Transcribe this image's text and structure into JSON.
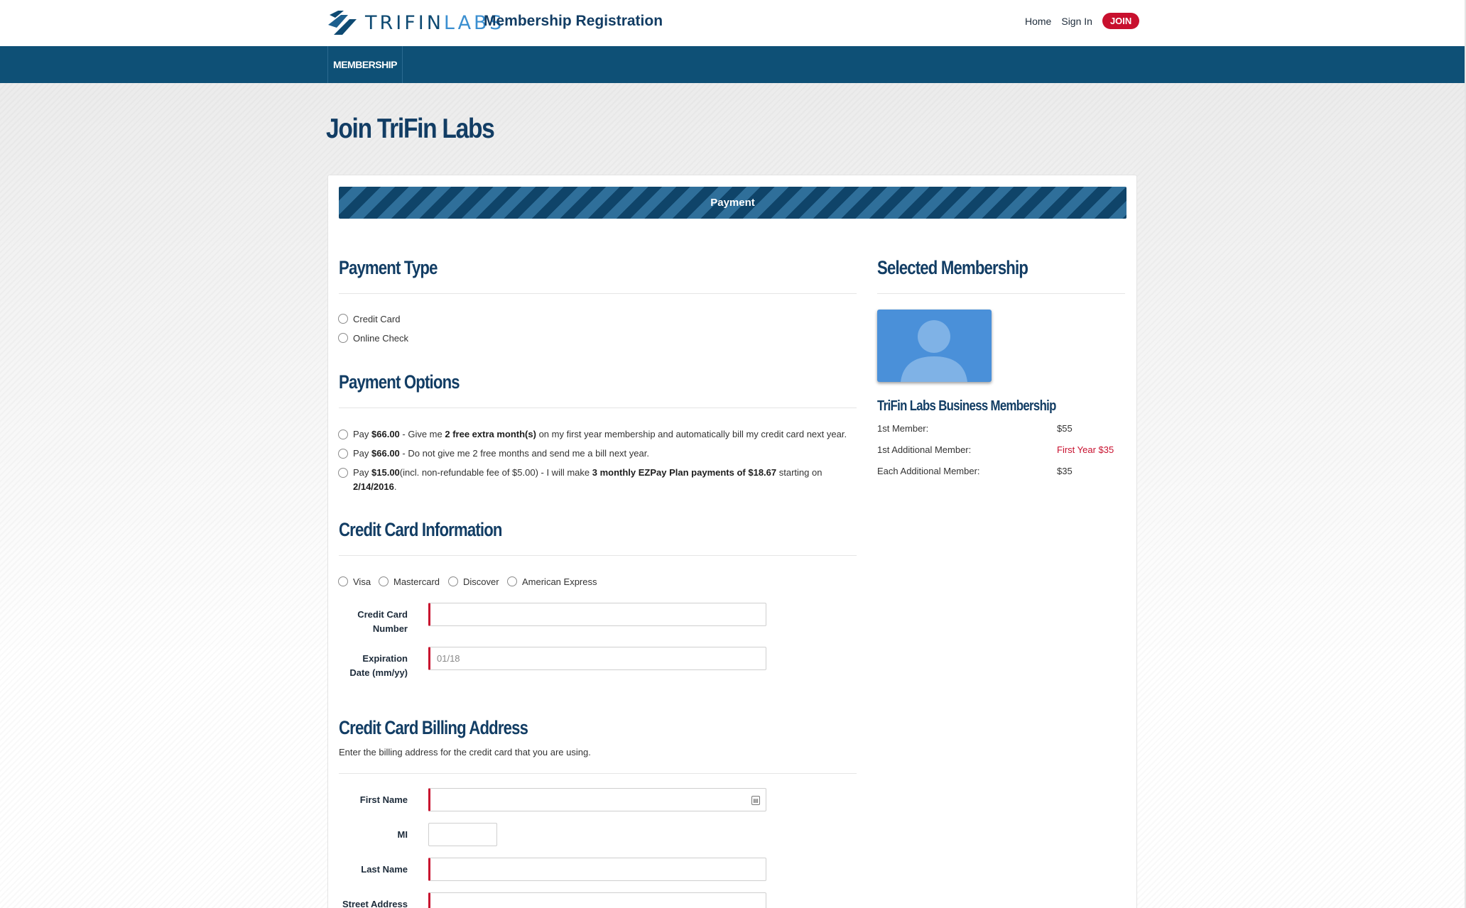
{
  "header": {
    "brand_left": "TRIFIN",
    "brand_right": "LABS",
    "site_title": "Membership Registration",
    "nav": {
      "home": "Home",
      "sign_in": "Sign In",
      "join": "JOIN"
    }
  },
  "navbar": {
    "item": "MEMBERSHIP"
  },
  "page": {
    "title": "Join TriFin Labs"
  },
  "step": {
    "label": "Payment"
  },
  "payment_type": {
    "heading": "Payment Type",
    "options": [
      "Credit Card",
      "Online Check"
    ]
  },
  "payment_options": {
    "heading": "Payment Options",
    "opt1": {
      "a": "Pay ",
      "b1": "$66.00",
      "c": " - Give me ",
      "b2": "2 free extra month(s)",
      "d": " on my first year membership and automatically bill my credit card next year."
    },
    "opt2": {
      "a": "Pay ",
      "b1": "$66.00",
      "c": " - Do not give me 2 free months and send me a bill next year."
    },
    "opt3": {
      "a": "Pay ",
      "b1": "$15.00",
      "c": "(incl. non-refundable fee of $5.00) - I will make ",
      "b2": "3 monthly EZPay Plan payments of $18.67",
      "d": " starting on",
      "b3": "2/14/2016",
      "e": "."
    }
  },
  "credit_card": {
    "heading": "Credit Card Information",
    "types": [
      "Visa",
      "Mastercard",
      "Discover",
      "American Express"
    ],
    "number_label_1": "Credit Card",
    "number_label_2": "Number",
    "number_value": "",
    "exp_label_1": "Expiration",
    "exp_label_2": "Date (mm/yy)",
    "exp_placeholder": "01/18"
  },
  "billing": {
    "heading": "Credit Card Billing Address",
    "description": "Enter the billing address for the credit card that you are using.",
    "first_name_label": "First Name",
    "mi_label": "MI",
    "last_name_label": "Last Name",
    "street_label": "Street Address"
  },
  "selected_membership": {
    "heading": "Selected Membership",
    "name": "TriFin Labs Business Membership",
    "rows": [
      {
        "label": "1st Member:",
        "value": "$55"
      },
      {
        "label": "1st Additional Member:",
        "value": "First Year $35"
      },
      {
        "label": "Each Additional Member:",
        "value": "$35"
      }
    ]
  },
  "colors": {
    "brand_dark": "#0e5076",
    "brand_title": "#123d64",
    "accent_red": "#c8102e",
    "avatar_blue": "#4a90d9"
  }
}
